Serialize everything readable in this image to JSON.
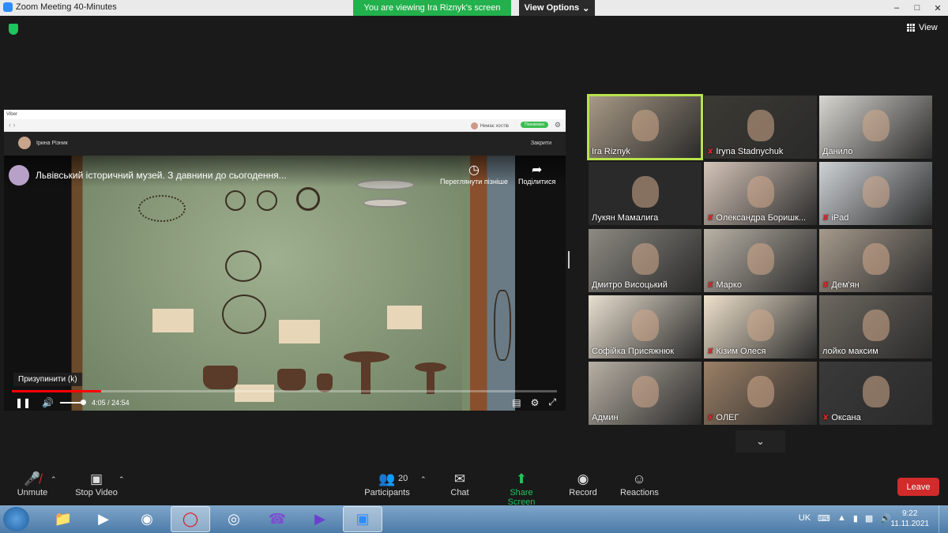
{
  "window": {
    "title": "Zoom Meeting 40-Minutes",
    "viewing_banner": "You are viewing Ira Riznyk's screen",
    "view_options": "View Options",
    "view_label": "View"
  },
  "shared_app": {
    "app_title": "Viber",
    "contact_label": "Немає хостів",
    "call_label": "Поновлюю",
    "chat_name": "Ірина Різник",
    "close_label": "Закрити"
  },
  "video": {
    "title": "Львівський історичний музей. З давнини до сьогодення...",
    "watch_later": "Переглянути пізніше",
    "share": "Поділитися",
    "pause_tooltip": "Призупинити (k)",
    "time": "4:05 / 24:54",
    "progress": 0.164
  },
  "participants": [
    {
      "name": "Ira Riznyk",
      "muted": false,
      "active": true,
      "bg": "#a89a86"
    },
    {
      "name": "Iryna Stadnychuk",
      "muted": true,
      "active": false,
      "bg": "#3b3a33"
    },
    {
      "name": "Данило",
      "muted": false,
      "active": false,
      "bg": "#d8d6d0"
    },
    {
      "name": "Лукян Мамалига",
      "muted": false,
      "active": false,
      "bg": "#2a2a2a"
    },
    {
      "name": "Олександра Боришк...",
      "muted": true,
      "active": false,
      "bg": "#d4c4b8"
    },
    {
      "name": "iPad",
      "muted": true,
      "active": false,
      "bg": "#cfd3d6"
    },
    {
      "name": "Дмитро Висоцький",
      "muted": false,
      "active": false,
      "bg": "#8d8a82"
    },
    {
      "name": "Марко",
      "muted": true,
      "active": false,
      "bg": "#b9b2a6"
    },
    {
      "name": "Дем'ян",
      "muted": true,
      "active": false,
      "bg": "#a69a8c"
    },
    {
      "name": "Софійка Присяжнюк",
      "muted": false,
      "active": false,
      "bg": "#e8dfcf"
    },
    {
      "name": "Кізим Олеся",
      "muted": true,
      "active": false,
      "bg": "#efe2cc"
    },
    {
      "name": "лойко максим",
      "muted": false,
      "active": false,
      "bg": "#6e6860"
    },
    {
      "name": "Админ",
      "muted": false,
      "active": false,
      "bg": "#b8b0a4"
    },
    {
      "name": "ОЛЕГ",
      "muted": true,
      "active": false,
      "bg": "#9b8066"
    },
    {
      "name": "Оксана",
      "muted": true,
      "active": false,
      "bg": "#3a3a3a"
    }
  ],
  "toolbar": {
    "unmute": "Unmute",
    "stop_video": "Stop Video",
    "participants": "Participants",
    "participant_count": "20",
    "chat": "Chat",
    "share_screen": "Share Screen",
    "record": "Record",
    "reactions": "Reactions",
    "leave": "Leave"
  },
  "taskbar": {
    "language": "UK",
    "time": "9:22",
    "date": "11.11.2021"
  }
}
